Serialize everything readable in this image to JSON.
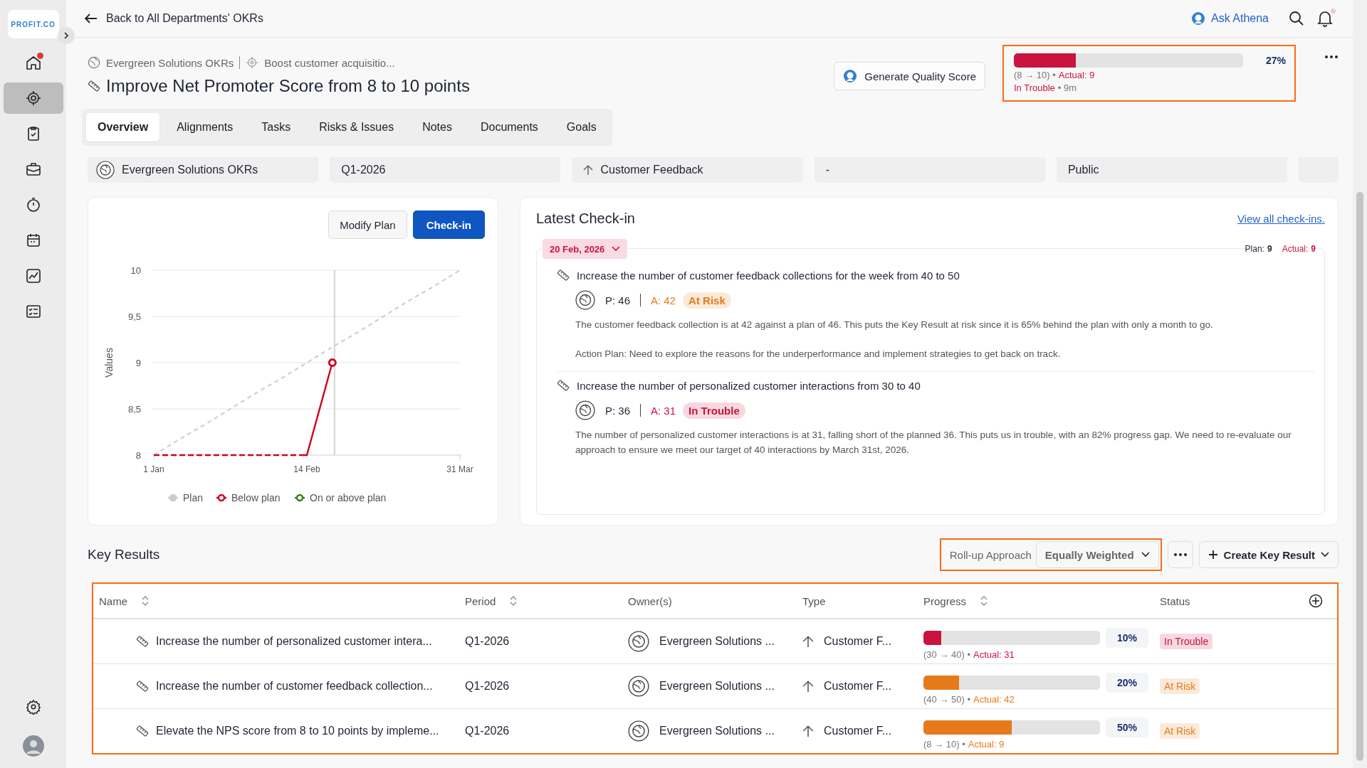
{
  "sidebar": {
    "logo": "PROFIT.CO",
    "items": [
      {
        "kind": "home",
        "selected": false,
        "notification": true
      },
      {
        "kind": "target",
        "selected": true,
        "notification": false
      },
      {
        "kind": "clipboard",
        "selected": false,
        "notification": false
      },
      {
        "kind": "briefcase",
        "selected": false,
        "notification": false
      },
      {
        "kind": "timer",
        "selected": false,
        "notification": false
      },
      {
        "kind": "calendar",
        "selected": false,
        "notification": false
      },
      {
        "kind": "chart",
        "selected": false,
        "notification": false
      },
      {
        "kind": "checklist",
        "selected": false,
        "notification": false
      }
    ]
  },
  "topbar": {
    "back_link": "Back to All Departments' OKRs",
    "ask_link": "Ask Athena",
    "notification": true
  },
  "header": {
    "breadcrumb": [
      "Evergreen Solutions OKRs",
      "Boost customer acquisitio..."
    ],
    "title": "Improve Net Promoter Score from 8 to 10 points",
    "quality_button": "Generate Quality Score",
    "progress": {
      "level": 0.27,
      "percent": "27%",
      "range": "(8 → 10) •",
      "actual": "Actual: 9",
      "status": "In Trouble",
      "color": "#c8143f",
      "age": "• 9m"
    }
  },
  "tabs": [
    {
      "label": "Overview",
      "selected": true
    },
    {
      "label": "Alignments",
      "selected": false
    },
    {
      "label": "Tasks",
      "selected": false
    },
    {
      "label": "Risks & Issues",
      "selected": false
    },
    {
      "label": "Notes",
      "selected": false
    },
    {
      "label": "Documents",
      "selected": false
    },
    {
      "label": "Goals",
      "selected": false
    }
  ],
  "info_cards": [
    {
      "kind": "owner",
      "text": "Evergreen Solutions OKRs"
    },
    {
      "kind": "plain",
      "text": "Q1-2026"
    },
    {
      "kind": "type",
      "text": "Customer Feedback"
    },
    {
      "kind": "plain",
      "text": "-"
    },
    {
      "kind": "plain",
      "text": "Public"
    },
    {
      "kind": "blank"
    }
  ],
  "plan_chart": {
    "buttons": [
      {
        "label": "Modify Plan",
        "kind": "secondary"
      },
      {
        "label": "Check-in",
        "kind": "primary"
      }
    ],
    "chart_data": {
      "type": "line",
      "ylabel": "Values",
      "grid": true,
      "legend": true,
      "categories": [
        "1 Jan",
        null,
        null,
        null,
        null,
        null,
        "14 Feb",
        null,
        null,
        null,
        null,
        null,
        "31 Mar"
      ],
      "ylim": [
        8,
        10
      ],
      "yticks": [
        8,
        {
          "value": 8.5,
          "label": "8,5"
        },
        9,
        {
          "value": 9.5,
          "label": "9,5"
        },
        10
      ],
      "series": [
        {
          "name": "Plan",
          "color": "#cccccc",
          "line_style": "dashed",
          "values": [
            8,
            8.17,
            8.33,
            8.5,
            8.67,
            8.83,
            9,
            9.17,
            9.33,
            9.5,
            9.67,
            9.83,
            10
          ]
        },
        {
          "name": "Below plan",
          "color": "#d0021b",
          "line_style": "dashed_then_solid",
          "values": [
            8,
            8,
            8,
            8,
            8,
            8,
            8,
            9,
            null,
            null,
            null,
            null,
            null
          ]
        },
        {
          "name": "On or above plan",
          "color": "#3a7d1e",
          "values": [
            null,
            null,
            null,
            null,
            null,
            null,
            null,
            null,
            null,
            null,
            null,
            null,
            null
          ]
        }
      ]
    }
  },
  "latest_checkin": {
    "title": "Latest Check-in",
    "view_all": "View all check-ins.",
    "date": "20 Feb, 2026",
    "plan_label": "Plan:",
    "plan_value": "9",
    "actual_label": "Actual:",
    "actual_value": "9",
    "entries": [
      {
        "title": "Increase the number of customer feedback collections for the week from 40 to 50",
        "plan": "P: 46",
        "actual": "A: 42",
        "status": "At Risk",
        "color": "#e57a1a",
        "paragraphs": [
          "The customer feedback collection is at 42 against a plan of 46. This puts the Key Result at risk since it is 65% behind the plan with only a month to go.",
          "Action Plan: Need to explore the reasons for the underperformance and implement strategies to get back on track."
        ]
      },
      {
        "title": "Increase the number of personalized customer interactions from 30 to 40",
        "plan": "P: 36",
        "actual": "A: 31",
        "status": "In Trouble",
        "color": "#c8143f",
        "paragraphs": [
          "The number of personalized customer interactions is at 31, falling short of the planned 36. This puts us in trouble, with an 82% progress gap. We need to re-evaluate our approach to ensure we meet our target of 40 interactions by March 31st, 2026."
        ]
      }
    ]
  },
  "key_results": {
    "title": "Key Results",
    "rollup_label": "Roll-up Approach",
    "rollup_value": "Equally Weighted",
    "create_button": "Create Key Result",
    "columns": [
      {
        "label": "Name",
        "sortable": true
      },
      {
        "label": "Period",
        "sortable": true
      },
      {
        "label": "Owner(s)",
        "sortable": false
      },
      {
        "label": "Type",
        "sortable": false
      },
      {
        "label": "Progress",
        "sortable": true
      },
      {
        "label": "Status",
        "sortable": false
      }
    ],
    "rows": [
      {
        "name": "Increase the number of personalized customer intera...",
        "period": "Q1-2026",
        "owner": "Evergreen Solutions ...",
        "type": "Customer F...",
        "level": 0.1,
        "percent": "10%",
        "range": "(30 → 40) •",
        "actual": "Actual: 31",
        "status": "In Trouble",
        "color": "#c8143f"
      },
      {
        "name": "Increase the number of customer feedback collection...",
        "period": "Q1-2026",
        "owner": "Evergreen Solutions ...",
        "type": "Customer F...",
        "level": 0.2,
        "percent": "20%",
        "range": "(40 → 50) •",
        "actual": "Actual: 42",
        "status": "At Risk",
        "color": "#e57a1a"
      },
      {
        "name": "Elevate the NPS score from 8 to 10 points by impleme...",
        "period": "Q1-2026",
        "owner": "Evergreen Solutions ...",
        "type": "Customer F...",
        "level": 0.5,
        "percent": "50%",
        "range": "(8 → 10) •",
        "actual": "Actual: 9",
        "status": "At Risk",
        "color": "#e57a1a"
      }
    ]
  }
}
